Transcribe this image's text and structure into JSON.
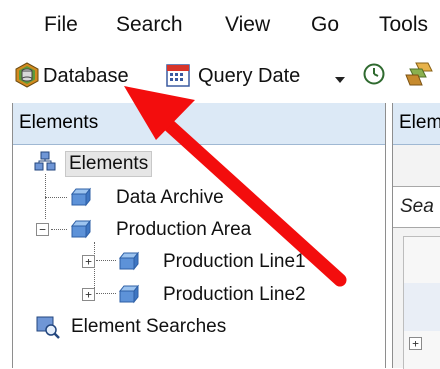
{
  "menubar": {
    "items": [
      "File",
      "Search",
      "View",
      "Go",
      "Tools"
    ]
  },
  "toolbar": {
    "database_label": "Database",
    "query_date_label": "Query Date",
    "database_icon": "database-icon",
    "calendar_icon": "calendar-icon",
    "clock_icon": "clock-icon"
  },
  "elements_panel": {
    "title": "Elements",
    "tree": {
      "root_label": "Elements",
      "children": [
        {
          "label": "Data Archive"
        },
        {
          "label": "Production Area"
        },
        {
          "label": "Production Line1"
        },
        {
          "label": "Production Line2"
        }
      ],
      "searches_label": "Element Searches"
    }
  },
  "right_panel": {
    "title": "Elem",
    "search_placeholder": "Sea"
  },
  "annotation": {
    "arrow_color": "#f30d0d"
  }
}
